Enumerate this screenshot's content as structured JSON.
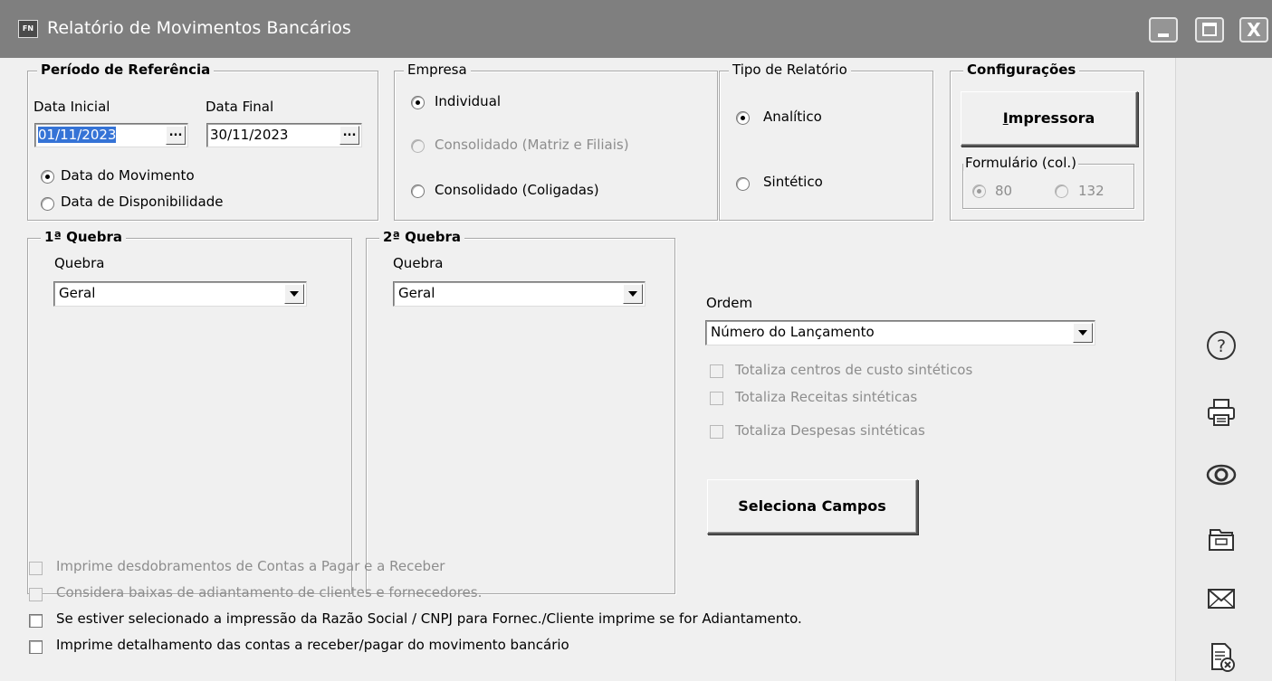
{
  "window": {
    "app_icon": "FN",
    "title": "Relatório de Movimentos Bancários",
    "controls": {
      "minimize": "minimize-icon",
      "maximize": "maximize-icon",
      "close": "X"
    }
  },
  "periodo": {
    "legend": "Período de Referência",
    "data_inicial_label": "Data Inicial",
    "data_inicial_value": "01/11/2023",
    "data_final_label": "Data Final",
    "data_final_value": "30/11/2023",
    "ellipsis": "...",
    "opt_movimento": "Data do Movimento",
    "opt_disponibilidade": "Data de Disponibilidade",
    "selected": "movimento"
  },
  "empresa": {
    "legend": "Empresa",
    "opt_individual": "Individual",
    "opt_consolidado_matriz": "Consolidado (Matriz e Filiais)",
    "opt_consolidado_coligadas": "Consolidado (Coligadas)",
    "selected": "individual"
  },
  "tipo_relatorio": {
    "legend": "Tipo de Relatório",
    "opt_analitico": "Analítico",
    "opt_sintetico": "Sintético",
    "selected": "analitico"
  },
  "configuracoes": {
    "legend": "Configurações",
    "impressora_label": "Impressora",
    "formulario_legend": "Formulário (col.)",
    "opt_80": "80",
    "opt_132": "132",
    "selected": "80"
  },
  "quebra1": {
    "legend": "1ª Quebra",
    "label": "Quebra",
    "value": "Geral"
  },
  "quebra2": {
    "legend": "2ª Quebra",
    "label": "Quebra",
    "value": "Geral"
  },
  "ordem": {
    "label": "Ordem",
    "value": "Número do Lançamento",
    "chk_centros": "Totaliza centros de custo sintéticos",
    "chk_receitas": "Totaliza Receitas sintéticas",
    "chk_despesas": "Totaliza Despesas sintéticas",
    "seleciona_campos": "Seleciona Campos"
  },
  "options": {
    "chk_desdobramentos": "Imprime desdobramentos de Contas a Pagar e a Receber",
    "chk_baixas": "Considera baixas de adiantamento de clientes e fornecedores.",
    "chk_razao_social": "Se estiver selecionado a impressão da Razão Social / CNPJ para Fornec./Cliente imprime se for Adiantamento.",
    "chk_detalhamento": "Imprime detalhamento das contas a receber/pagar do movimento bancário"
  },
  "sidebar": {
    "icons": [
      "help-icon",
      "printer-icon",
      "preview-eye-icon",
      "export-file-icon",
      "email-icon",
      "close-document-icon"
    ]
  },
  "colors": {
    "titlebar": "#7f7f7f",
    "selection": "#3573d6",
    "disabled_text": "#8d8d8d"
  }
}
